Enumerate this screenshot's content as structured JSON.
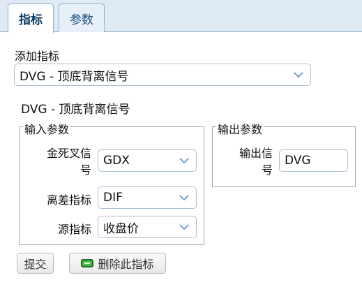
{
  "tabs": [
    {
      "label": "指标",
      "active": true
    },
    {
      "label": "参数",
      "active": false
    }
  ],
  "add_indicator": {
    "label": "添加指标",
    "selected": "DVG - 顶底背离信号"
  },
  "indicator_title": "DVG - 顶底背离信号",
  "inputs": {
    "legend": "输入参数",
    "fields": [
      {
        "label_line1": "金死叉信",
        "label_line2": "号",
        "value": "GDX"
      },
      {
        "label": "离差指标",
        "value": "DIF"
      },
      {
        "label": "源指标",
        "value": "收盘价"
      }
    ]
  },
  "outputs": {
    "legend": "输出参数",
    "field": {
      "label_line1": "输出信",
      "label_line2": "号",
      "value": "DVG"
    }
  },
  "buttons": {
    "submit": "提交",
    "delete": "删除此指标",
    "delete_icon": "minus-square-icon"
  },
  "colors": {
    "tab_bar": "#dfeaf5",
    "tab_border": "#8fb2d6",
    "delete_icon": "#48b848"
  }
}
